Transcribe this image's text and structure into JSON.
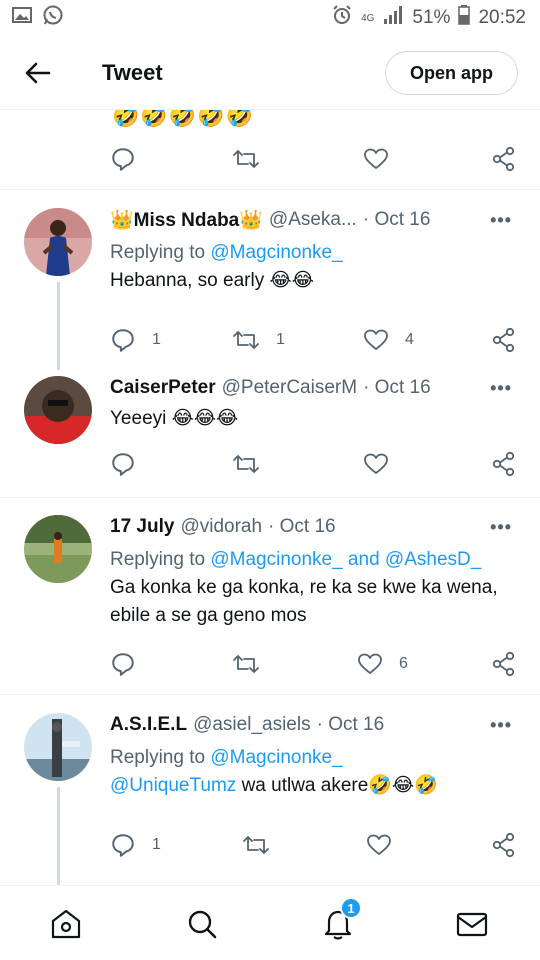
{
  "status_bar": {
    "network": "4G",
    "battery": "51%",
    "time": "20:52"
  },
  "header": {
    "title": "Tweet",
    "open_app_label": "Open app"
  },
  "partial_tweet": {
    "emoji": "🤣🤣🤣🤣🤣"
  },
  "tweets": [
    {
      "name": "👑Miss Ndaba👑",
      "handle": "@Aseka...",
      "date": "· Oct 16",
      "replying_prefix": "Replying to ",
      "replying_to": "@Magcinonke_",
      "text": "Hebanna, so early 😂😂",
      "replies": "1",
      "retweets": "1",
      "likes": "4"
    },
    {
      "name": "CaiserPeter",
      "handle": "@PeterCaiserM",
      "date": "· Oct 16",
      "text": "Yeeeyi 😂😂😂",
      "replies": "",
      "retweets": "",
      "likes": ""
    },
    {
      "name": "17 July",
      "handle": "@vidorah",
      "date": "· Oct 16",
      "replying_prefix": "Replying to ",
      "replying_to": "@Magcinonke_",
      "replying_and": " and ",
      "replying_to_2": "@AshesD_",
      "text": "Ga konka ke ga konka, re ka se kwe ka wena, ebile a se ga geno mos",
      "replies": "",
      "retweets": "",
      "likes": "6"
    },
    {
      "name": "A.S.I.E.L",
      "handle": "@asiel_asiels",
      "date": "· Oct 16",
      "replying_prefix": "Replying to ",
      "replying_to": "@Magcinonke_",
      "mention": "@UniqueTumz",
      "text": " wa utlwa akere🤣😂🤣",
      "replies": "1",
      "retweets": "",
      "likes": ""
    }
  ],
  "more_label": "•••",
  "bottom_nav": {
    "notifications_badge": "1"
  },
  "colors": {
    "link": "#1d9bf0",
    "secondary": "#536471",
    "divider": "#eff3f4"
  }
}
